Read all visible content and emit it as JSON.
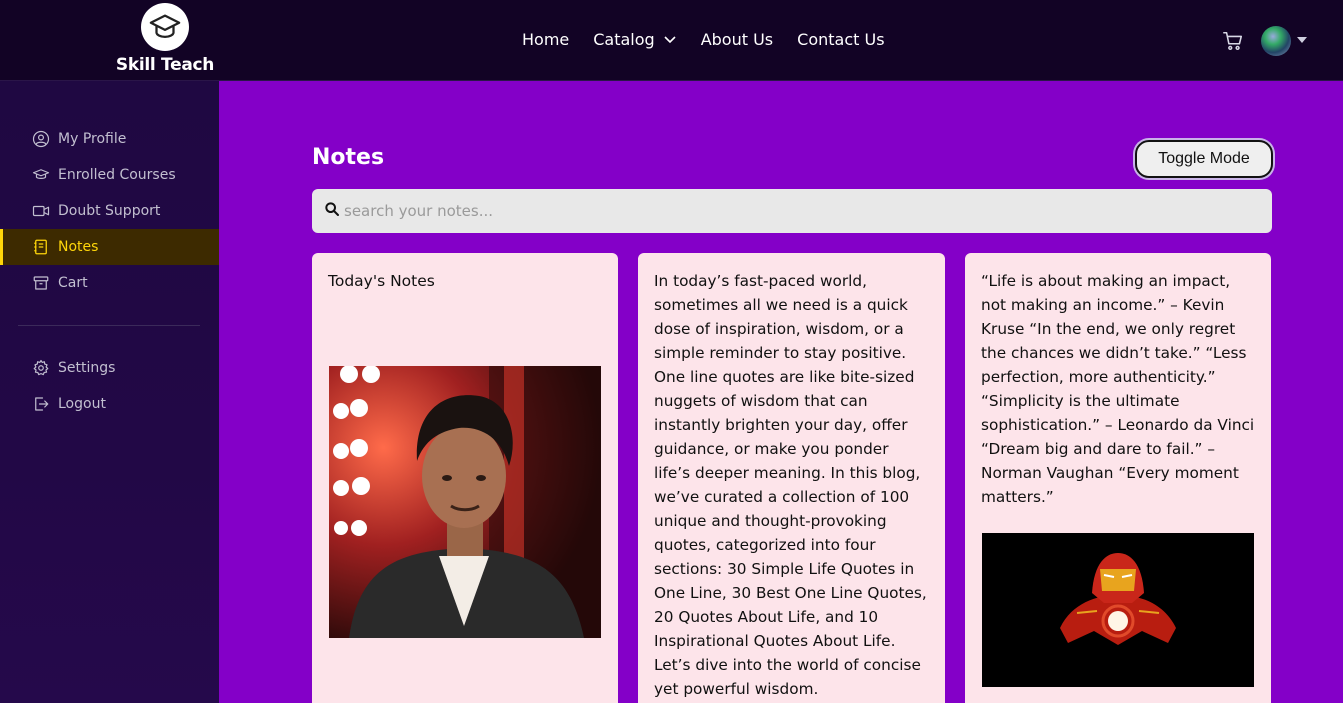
{
  "brand": {
    "name": "Skill Teach"
  },
  "nav": {
    "home": "Home",
    "catalog": "Catalog",
    "about": "About Us",
    "contact": "Contact Us"
  },
  "sidebar": {
    "items": [
      {
        "label": "My Profile",
        "icon": "user-circle-icon"
      },
      {
        "label": "Enrolled Courses",
        "icon": "graduation-cap-icon"
      },
      {
        "label": "Doubt Support",
        "icon": "video-icon"
      },
      {
        "label": "Notes",
        "icon": "notebook-icon",
        "active": true
      },
      {
        "label": "Cart",
        "icon": "archive-icon"
      }
    ],
    "bottom": [
      {
        "label": "Settings",
        "icon": "gear-icon"
      },
      {
        "label": "Logout",
        "icon": "logout-icon"
      }
    ]
  },
  "main": {
    "title": "Notes",
    "toggle_label": "Toggle Mode",
    "search_placeholder": "search your notes..."
  },
  "cards": [
    {
      "text": "Today's Notes"
    },
    {
      "text": "In today’s fast-paced world, sometimes all we need is a quick dose of inspiration, wisdom, or a simple reminder to stay positive. One line quotes are like bite-sized nuggets of wisdom that can instantly brighten your day, offer guidance, or make you ponder life’s deeper meaning. In this blog, we’ve curated a collection of 100 unique and thought-provoking quotes, categorized into four sections: 30 Simple Life Quotes in One Line, 30 Best One Line Quotes, 20 Quotes About Life, and 10 Inspirational Quotes About Life. Let’s dive into the world of concise yet powerful wisdom."
    },
    {
      "text": "“Life is about making an impact, not making an income.” – Kevin Kruse “In the end, we only regret the chances we didn’t take.” “Less perfection, more authenticity.” “Simplicity is the ultimate sophistication.” – Leonardo da Vinci “Dream big and dare to fail.” – Norman Vaughan “Every moment matters.”"
    }
  ],
  "colors": {
    "header_bg": "#120325",
    "sidebar_bg": "#1f0842",
    "main_bg": "#8400c8",
    "card_bg": "#fde4ea",
    "active_accent": "#ffd60a"
  }
}
